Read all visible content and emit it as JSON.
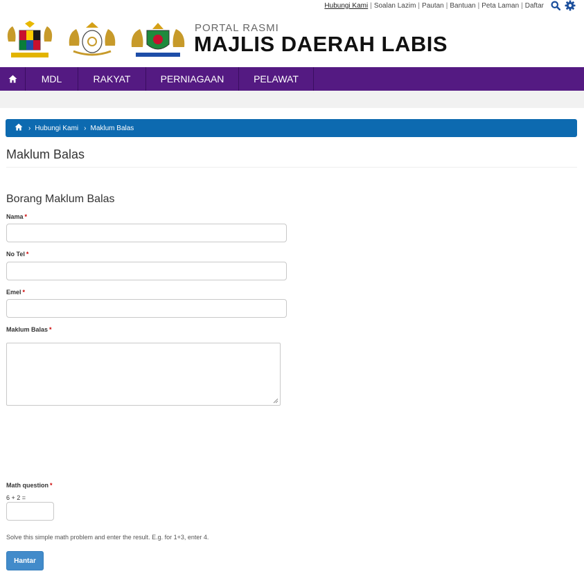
{
  "toplinks": [
    "Hubungi Kami",
    "Soalan Lazim",
    "Pautan",
    "Bantuan",
    "Peta Laman",
    "Daftar"
  ],
  "brand": {
    "subtitle": "PORTAL RASMI",
    "title": "MAJLIS DAERAH LABIS"
  },
  "nav": {
    "items": [
      "MDL",
      "RAKYAT",
      "PERNIAGAAN",
      "PELAWAT"
    ]
  },
  "breadcrumb": [
    "Hubungi Kami",
    "Maklum Balas"
  ],
  "page_title": "Maklum Balas",
  "form": {
    "title": "Borang Maklum Balas",
    "required_mark": "*",
    "fields": {
      "nama": {
        "label": "Nama",
        "value": ""
      },
      "notel": {
        "label": "No Tel",
        "value": ""
      },
      "emel": {
        "label": "Emel",
        "value": ""
      },
      "maklumbalas": {
        "label": "Maklum Balas",
        "value": ""
      }
    },
    "math": {
      "label": "Math question",
      "question": "6 + 2 =",
      "hint": "Solve this simple math problem and enter the result. E.g. for 1+3, enter 4.",
      "value": ""
    },
    "submit_label": "Hantar"
  },
  "colors": {
    "nav": "#541a82",
    "breadcrumb": "#0d6ab0",
    "button": "#428bca",
    "icon": "#1c4f9c"
  }
}
